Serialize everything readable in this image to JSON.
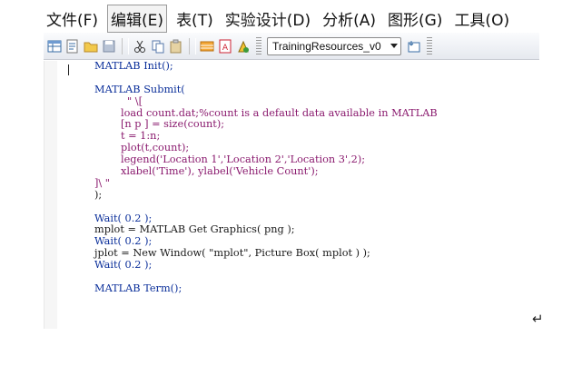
{
  "menubar": {
    "items": [
      {
        "label": "文件(F)"
      },
      {
        "label": "编辑(E)"
      },
      {
        "label": "表(T)"
      },
      {
        "label": "实验设计(D)"
      },
      {
        "label": "分析(A)"
      },
      {
        "label": "图形(G)"
      },
      {
        "label": "工具(O)"
      }
    ]
  },
  "toolbar": {
    "combo_value": "TrainingResources_v0",
    "icons": [
      "new-data-table-icon",
      "new-script-icon",
      "open-icon",
      "save-icon",
      "cut-icon",
      "copy-icon",
      "paste-icon",
      "data-table-icon",
      "report-icon",
      "run-script-icon"
    ]
  },
  "script": {
    "line1": "MATLAB Init();",
    "line2": "MATLAB Submit(",
    "line3": "\" \\[",
    "line4": "load count.dat;%count is a default data available in MATLAB",
    "line5": "[n p ] = size(count);",
    "line6": "t = 1:n;",
    "line7": "plot(t,count);",
    "line8": "legend('Location 1','Location 2','Location 3',2);",
    "line9": "xlabel('Time'), ylabel('Vehicle Count');",
    "line10": "]\\ \"",
    "line11": ");",
    "line12": "Wait( 0.2 );",
    "line13": "mplot = MATLAB Get Graphics( png );",
    "line14": "Wait( 0.2 );",
    "line15": "jplot = New Window( \"mplot\", Picture Box( mplot ) );",
    "line16": "Wait( 0.2 );",
    "line17": "MATLAB Term();"
  },
  "paragraph_mark": "↵",
  "colors": {
    "keyword": "#0b2f9a",
    "string": "#8a1a6e",
    "text": "#1a1a1a"
  }
}
